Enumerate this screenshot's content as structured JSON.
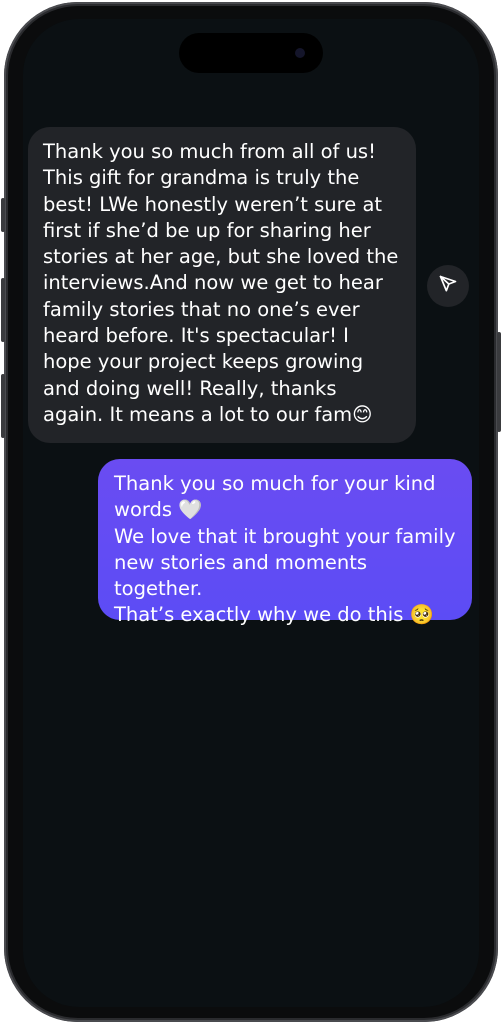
{
  "chat": {
    "received_message": "Thank you so much from all of us!\nThis gift for grandma is truly the best! LWe honestly weren’t sure at first if she’d be up for sharing her stories at her age, but she loved the interviews.And now we get to hear family stories that no one’s ever heard before. It's spectacular! I hope your project keeps growing and doing well! Really, thanks again. It means a lot to our fam😊",
    "sent_message": "Thank you so much for your kind words 🤍\nWe love that it brought your family new stories and moments together.\nThat’s exactly why we do this 🥺"
  },
  "icons": {
    "share": "send-icon"
  },
  "colors": {
    "background": "#0b1013",
    "received_bubble": "#222428",
    "sent_bubble": "#6a4cf2"
  }
}
